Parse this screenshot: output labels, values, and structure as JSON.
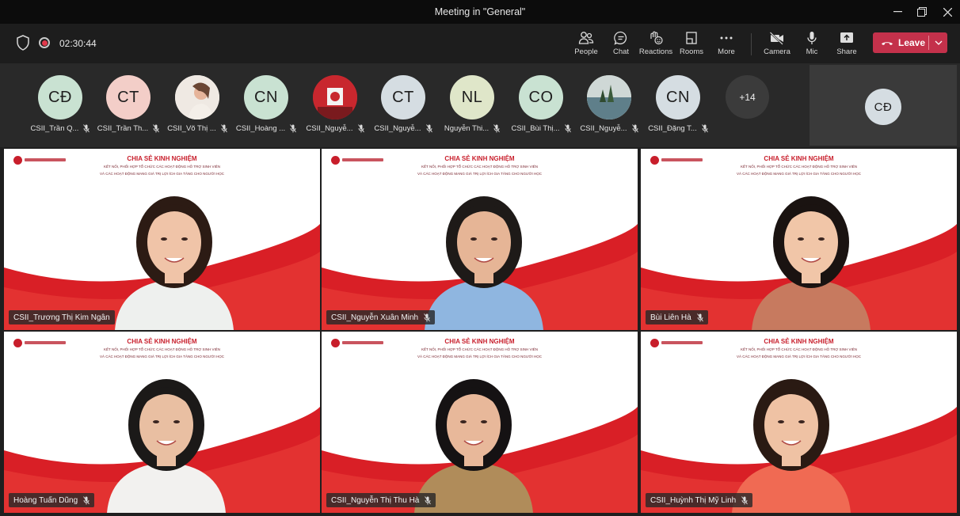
{
  "window": {
    "title": "Meeting in \"General\""
  },
  "toolbar": {
    "timer": "02:30:44",
    "buttons": [
      {
        "label": "People",
        "icon": "people-icon"
      },
      {
        "label": "Chat",
        "icon": "chat-icon"
      },
      {
        "label": "Reactions",
        "icon": "reactions-icon"
      },
      {
        "label": "Rooms",
        "icon": "rooms-icon"
      },
      {
        "label": "More",
        "icon": "more-icon"
      },
      {
        "label": "Camera",
        "icon": "camera-off-icon"
      },
      {
        "label": "Mic",
        "icon": "mic-icon"
      },
      {
        "label": "Share",
        "icon": "share-icon"
      }
    ],
    "leave_label": "Leave"
  },
  "strip": {
    "participants": [
      {
        "initials": "CĐ",
        "name": "CSII_Trần Q...",
        "color": "#c9e2d2"
      },
      {
        "initials": "CT",
        "name": "CSII_Trần Th...",
        "color": "#f3cec8"
      },
      {
        "initials": "",
        "name": "CSII_Võ Thị ...",
        "color": "#e9e3de"
      },
      {
        "initials": "CN",
        "name": "CSII_Hoàng ...",
        "color": "#c9e2d2"
      },
      {
        "initials": "",
        "name": "CSII_Nguyễ...",
        "color": "#c8272e"
      },
      {
        "initials": "CT",
        "name": "CSII_Nguyễ...",
        "color": "#d5dde2"
      },
      {
        "initials": "NL",
        "name": "Nguyễn Thi...",
        "color": "#dfe6c9"
      },
      {
        "initials": "CO",
        "name": "CSII_Bùi Thị...",
        "color": "#c9e2d2"
      },
      {
        "initials": "",
        "name": "CSII_Nguyễ...",
        "color": "#b9c7b8"
      },
      {
        "initials": "CN",
        "name": "CSII_Đặng T...",
        "color": "#d5dde2"
      }
    ],
    "more_count": "+14",
    "self_initials": "CĐ"
  },
  "banner": {
    "title": "CHIA SẺ KINH NGHIỆM",
    "line1": "KẾT NỐI, PHỐI HỢP TỔ CHỨC CÁC HOẠT ĐỘNG HỖ TRỢ SINH VIÊN",
    "line2": "VÀ CÁC HOẠT ĐỘNG MANG GIÁ TRỊ LỢI ÍCH GIA TĂNG CHO NGƯỜI HỌC"
  },
  "tiles": [
    {
      "name": "CSII_Trương Thị Kim Ngân",
      "muted": false
    },
    {
      "name": "CSII_Nguyễn Xuân Minh",
      "muted": true
    },
    {
      "name": "Bùi Liên Hà",
      "muted": true
    },
    {
      "name": "Hoàng Tuấn Dũng",
      "muted": true
    },
    {
      "name": "CSII_Nguyễn Thị Thu Hà",
      "muted": true
    },
    {
      "name": "CSII_Huỳnh Thị Mỹ Linh",
      "muted": true
    }
  ],
  "colors": {
    "leave": "#c4314b",
    "brand_red": "#d91f26"
  }
}
